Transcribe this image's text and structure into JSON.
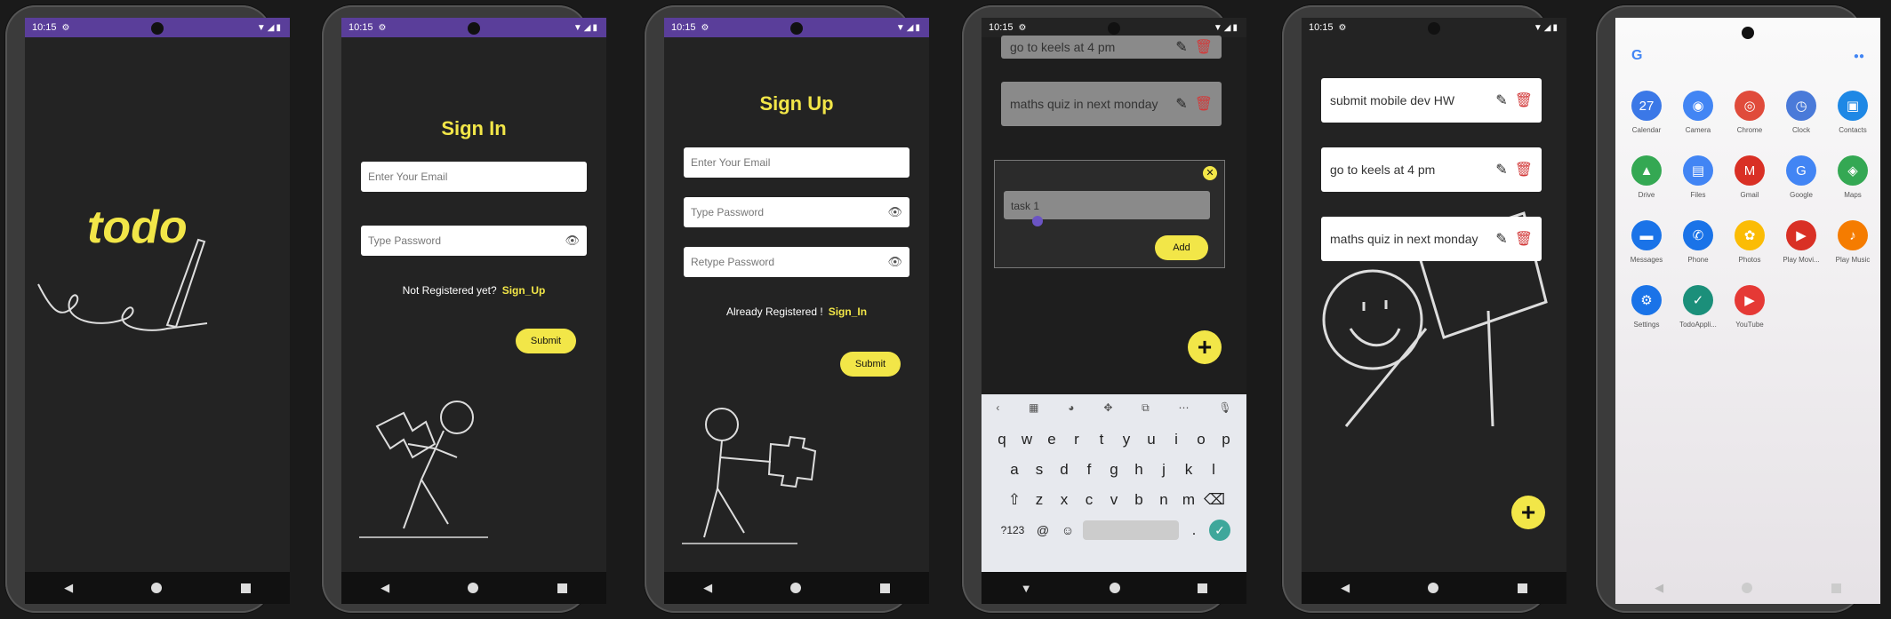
{
  "status": {
    "time": "10:15"
  },
  "screen1": {
    "logo": "todo"
  },
  "signin": {
    "title": "Sign In",
    "email_placeholder": "Enter Your Email",
    "password_placeholder": "Type Password",
    "prompt": "Not Registered yet?",
    "link": "Sign_Up",
    "submit": "Submit"
  },
  "signup": {
    "title": "Sign Up",
    "email_placeholder": "Enter Your Email",
    "password_placeholder": "Type Password",
    "retype_placeholder": "Retype Password",
    "prompt": "Already Registered !",
    "link": "Sign_In",
    "submit": "Submit"
  },
  "addtask": {
    "bg_tasks": [
      "go to keels at 4 pm",
      "maths quiz in next monday"
    ],
    "input_value": "task 1",
    "add_label": "Add",
    "kb_row1": [
      "q",
      "w",
      "e",
      "r",
      "t",
      "y",
      "u",
      "i",
      "o",
      "p"
    ],
    "kb_row2": [
      "a",
      "s",
      "d",
      "f",
      "g",
      "h",
      "j",
      "k",
      "l"
    ],
    "kb_row3": [
      "z",
      "x",
      "c",
      "v",
      "b",
      "n",
      "m"
    ],
    "kb_symbols": "?123",
    "kb_at": "@",
    "kb_dot": "."
  },
  "tasks": [
    "submit mobile dev HW",
    "go to keels at 4 pm",
    "maths quiz in next monday"
  ],
  "launcher": {
    "apps": [
      {
        "name": "Calendar",
        "color": "#3b78e7",
        "glyph": "27"
      },
      {
        "name": "Camera",
        "color": "#4285f4",
        "glyph": "◉"
      },
      {
        "name": "Chrome",
        "color": "#e04b3b",
        "glyph": "◎"
      },
      {
        "name": "Clock",
        "color": "#4a7ad9",
        "glyph": "◷"
      },
      {
        "name": "Contacts",
        "color": "#1e88e5",
        "glyph": "▣"
      },
      {
        "name": "Drive",
        "color": "#34a853",
        "glyph": "▲"
      },
      {
        "name": "Files",
        "color": "#4285f4",
        "glyph": "▤"
      },
      {
        "name": "Gmail",
        "color": "#d93025",
        "glyph": "M"
      },
      {
        "name": "Google",
        "color": "#4285f4",
        "glyph": "G"
      },
      {
        "name": "Maps",
        "color": "#34a853",
        "glyph": "◈"
      },
      {
        "name": "Messages",
        "color": "#1a73e8",
        "glyph": "▬"
      },
      {
        "name": "Phone",
        "color": "#1a73e8",
        "glyph": "✆"
      },
      {
        "name": "Photos",
        "color": "#fbbc05",
        "glyph": "✿"
      },
      {
        "name": "Play Movi...",
        "color": "#d93025",
        "glyph": "▶"
      },
      {
        "name": "Play Music",
        "color": "#f57c00",
        "glyph": "♪"
      },
      {
        "name": "Settings",
        "color": "#1a73e8",
        "glyph": "⚙"
      },
      {
        "name": "TodoAppli...",
        "color": "#1b8f7a",
        "glyph": "✓"
      },
      {
        "name": "YouTube",
        "color": "#e53935",
        "glyph": "▶"
      }
    ]
  }
}
